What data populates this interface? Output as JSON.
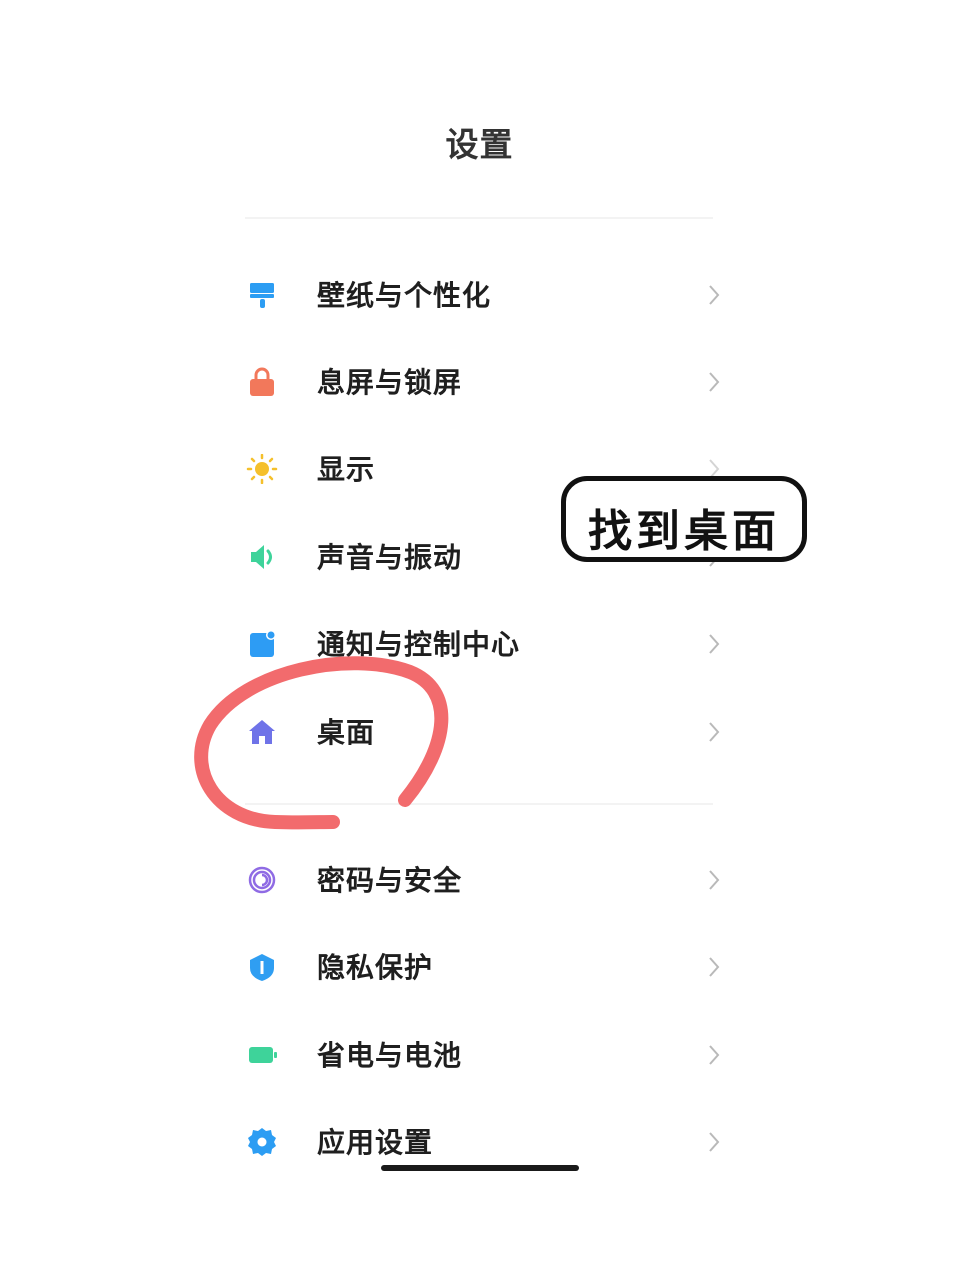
{
  "header": {
    "title": "设置"
  },
  "sections": [
    {
      "items": [
        {
          "label": "壁纸与个性化",
          "icon": "brush-icon",
          "color": "#2c9df3"
        },
        {
          "label": "息屏与锁屏",
          "icon": "lock-icon",
          "color": "#f2785b"
        },
        {
          "label": "显示",
          "icon": "sun-icon",
          "color": "#f5c02b"
        },
        {
          "label": "声音与振动",
          "icon": "speaker-icon",
          "color": "#3ed39a"
        },
        {
          "label": "通知与控制中心",
          "icon": "notification-icon",
          "color": "#2d9cf4"
        },
        {
          "label": "桌面",
          "icon": "home-icon",
          "color": "#6f73e8"
        }
      ]
    },
    {
      "items": [
        {
          "label": "密码与安全",
          "icon": "fingerprint-icon",
          "color": "#8f6be4"
        },
        {
          "label": "隐私保护",
          "icon": "privacy-shield-icon",
          "color": "#2f9ef2"
        },
        {
          "label": "省电与电池",
          "icon": "battery-icon",
          "color": "#3ed39a"
        },
        {
          "label": "应用设置",
          "icon": "gear-icon",
          "color": "#2c9df3"
        }
      ]
    }
  ],
  "annotation": {
    "sticker_text": "找到桌面",
    "circle_color": "#f26b6d"
  }
}
